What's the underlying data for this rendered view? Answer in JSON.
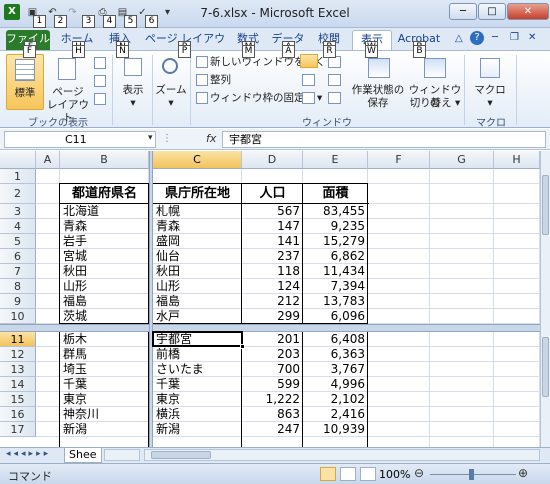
{
  "window": {
    "title": "7-6.xlsx - Microsoft Excel"
  },
  "qat": {
    "keytips": [
      "1",
      "2",
      "3",
      "4",
      "5",
      "6"
    ]
  },
  "tabs": [
    {
      "label": "ファイル",
      "keytip": "F"
    },
    {
      "label": "ホーム",
      "keytip": "H"
    },
    {
      "label": "挿入",
      "keytip": "N"
    },
    {
      "label": "ページ レイアウト",
      "keytip": "P"
    },
    {
      "label": "数式",
      "keytip": "M"
    },
    {
      "label": "データ",
      "keytip": "A"
    },
    {
      "label": "校閲",
      "keytip": "R"
    },
    {
      "label": "表示",
      "keytip": "W"
    },
    {
      "label": "Acrobat",
      "keytip": "B"
    }
  ],
  "ribbon": {
    "book_view": {
      "label": "ブックの表示",
      "normal": "標準",
      "page_layout_1": "ページ",
      "page_layout_2": "レイアウト"
    },
    "show": "表示",
    "zoom": "ズーム",
    "window": {
      "label": "ウィンドウ",
      "new_window": "新しいウィンドウを開く",
      "arrange": "整列",
      "freeze": "ウィンドウ枠の固定",
      "save_ws_1": "作業状態の",
      "save_ws_2": "保存",
      "switch_1": "ウィンドウの",
      "switch_2": "切り替え"
    },
    "macro": {
      "label": "マクロ",
      "button": "マクロ"
    }
  },
  "formula_bar": {
    "name_box": "C11",
    "fx": "fx",
    "value": "宇都宮"
  },
  "columns": [
    "A",
    "B",
    "C",
    "D",
    "E",
    "F",
    "G",
    "H"
  ],
  "headers": {
    "pref": "都道府県名",
    "capital": "県庁所在地",
    "pop": "人口",
    "area": "面積"
  },
  "rows_top": [
    {
      "n": "1"
    },
    {
      "n": "2"
    },
    {
      "n": "3",
      "pref": "北海道",
      "capital": "札幌",
      "pop": "567",
      "area": "83,455"
    },
    {
      "n": "4",
      "pref": "青森",
      "capital": "青森",
      "pop": "147",
      "area": "9,235"
    },
    {
      "n": "5",
      "pref": "岩手",
      "capital": "盛岡",
      "pop": "141",
      "area": "15,279"
    },
    {
      "n": "6",
      "pref": "宮城",
      "capital": "仙台",
      "pop": "237",
      "area": "6,862"
    },
    {
      "n": "7",
      "pref": "秋田",
      "capital": "秋田",
      "pop": "118",
      "area": "11,434"
    },
    {
      "n": "8",
      "pref": "山形",
      "capital": "山形",
      "pop": "124",
      "area": "7,394"
    },
    {
      "n": "9",
      "pref": "福島",
      "capital": "福島",
      "pop": "212",
      "area": "13,783"
    },
    {
      "n": "10",
      "pref": "茨城",
      "capital": "水戸",
      "pop": "299",
      "area": "6,096"
    }
  ],
  "rows_bottom": [
    {
      "n": "11",
      "pref": "栃木",
      "capital": "宇都宮",
      "pop": "201",
      "area": "6,408"
    },
    {
      "n": "12",
      "pref": "群馬",
      "capital": "前橋",
      "pop": "203",
      "area": "6,363"
    },
    {
      "n": "13",
      "pref": "埼玉",
      "capital": "さいたま",
      "pop": "700",
      "area": "3,767"
    },
    {
      "n": "14",
      "pref": "千葉",
      "capital": "千葉",
      "pop": "599",
      "area": "4,996"
    },
    {
      "n": "15",
      "pref": "東京",
      "capital": "東京",
      "pop": "1,222",
      "area": "2,102"
    },
    {
      "n": "16",
      "pref": "神奈川",
      "capital": "横浜",
      "pop": "863",
      "area": "2,416"
    },
    {
      "n": "17",
      "pref": "新潟",
      "capital": "新潟",
      "pop": "247",
      "area": "10,939"
    }
  ],
  "sheet_tab": "Shee",
  "status": {
    "mode": "コマンド",
    "zoom": "100%"
  },
  "colors": {
    "file_tab": "#2a7b2a",
    "selected_header": "#f3c35a",
    "accent": "#15428b"
  }
}
